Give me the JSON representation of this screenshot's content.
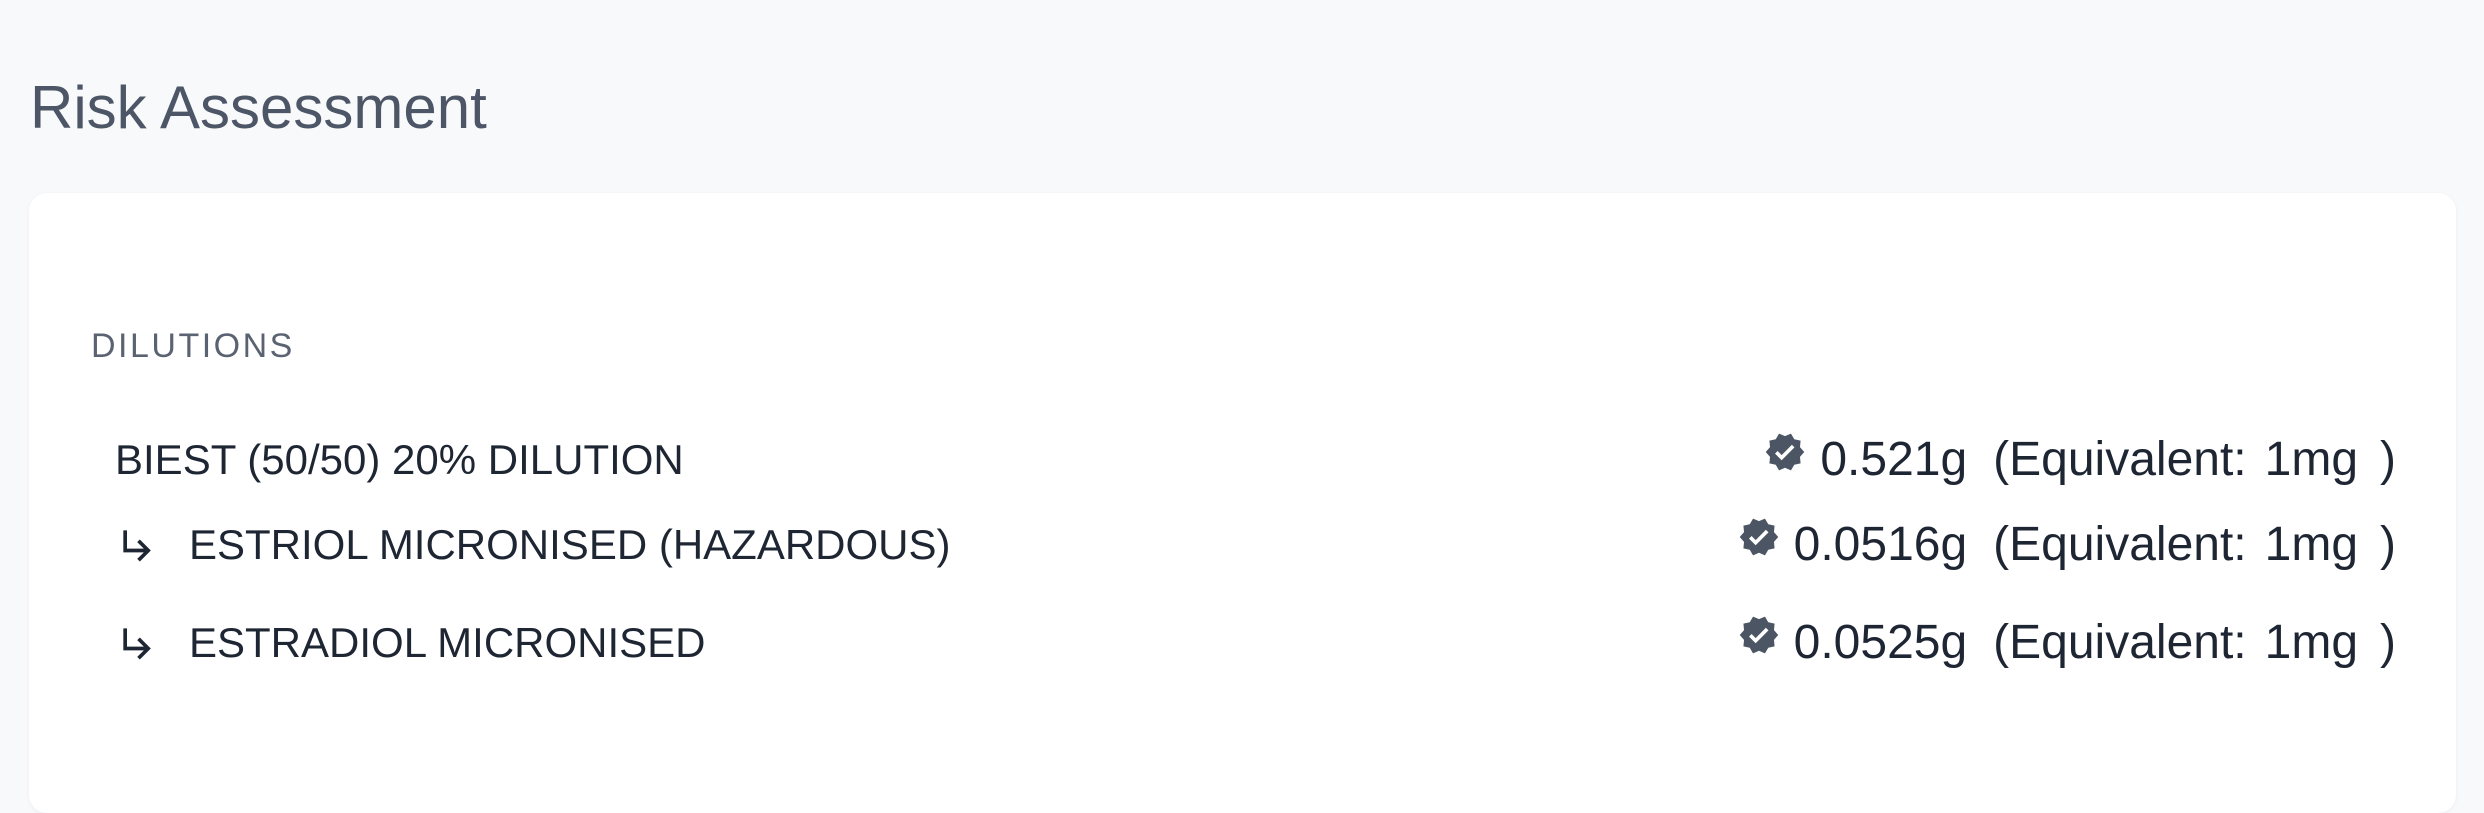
{
  "page_title": "Risk Assessment",
  "dilutions": {
    "section_label": "DILUTIONS",
    "rows": [
      {
        "name": "BIEST (50/50) 20% DILUTION",
        "is_child": false,
        "status_icon": "verified-badge-icon",
        "amount": "0.521g",
        "open_paren": "(",
        "equivalent_label": "Equivalent:",
        "equivalent_value": "1mg",
        "close_paren": ")"
      },
      {
        "name": "ESTRIOL MICRONISED (HAZARDOUS)",
        "is_child": true,
        "child_icon": "subdirectory-arrow-right-icon",
        "status_icon": "verified-badge-icon",
        "amount": "0.0516g",
        "open_paren": "(",
        "equivalent_label": "Equivalent:",
        "equivalent_value": "1mg",
        "close_paren": ")"
      },
      {
        "name": "ESTRADIOL MICRONISED",
        "is_child": true,
        "child_icon": "subdirectory-arrow-right-icon",
        "status_icon": "verified-badge-icon",
        "amount": "0.0525g",
        "open_paren": "(",
        "equivalent_label": "Equivalent:",
        "equivalent_value": "1mg",
        "close_paren": ")"
      }
    ]
  },
  "colors": {
    "page_background": "#f8f9fb",
    "card_background": "#ffffff",
    "title_text": "#4d5666",
    "body_text": "#1f2633",
    "icon": "#4b5563"
  }
}
